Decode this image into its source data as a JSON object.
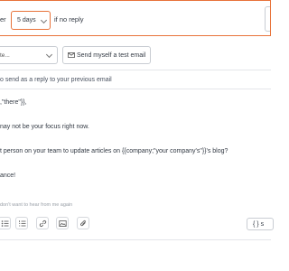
{
  "schedule": {
    "after_label_tail": "er",
    "days_value": "5 days",
    "no_reply_label": "if no reply"
  },
  "template": {
    "select_value": "te..."
  },
  "test_email": {
    "label": "Send myself a test email",
    "icon": "envelope-icon"
  },
  "reply": {
    "label": "o send as a reply to your previous email"
  },
  "body": {
    "lines": [
      ",\"there\"}},",
      "nay not be your focus right now.",
      "t person on your team to update articles on {{company;\"your company's\"}}'s blog?",
      "ance!"
    ]
  },
  "footer": {
    "unsubscribe": "don't want to hear from me again"
  },
  "toolbar": {
    "buttons": [
      "bullet-list-icon",
      "numbered-list-icon",
      "link-icon",
      "image-icon",
      "attachment-icon"
    ],
    "variables_label": "{ } s"
  },
  "colors": {
    "accent": "#e8733a",
    "border": "#c9cdd3",
    "text": "#333a44"
  }
}
